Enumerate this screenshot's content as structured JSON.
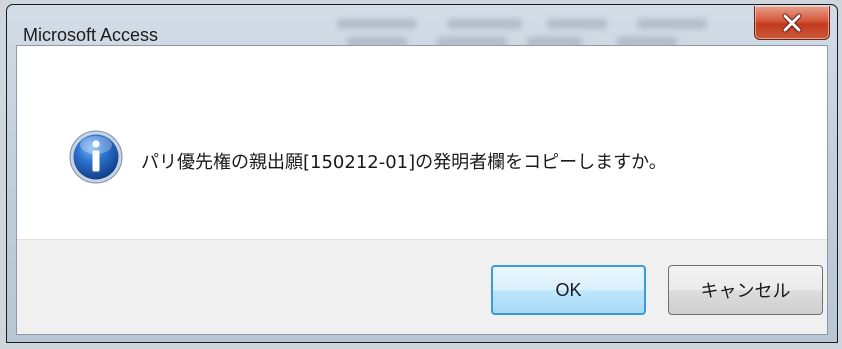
{
  "dialog": {
    "title": "Microsoft Access",
    "message": "パリ優先権の親出願[150212-01]の発明者欄をコピーしますか。",
    "icon": "information-icon",
    "ok_label": "OK",
    "cancel_label": "キャンセル",
    "close_icon": "close-icon"
  },
  "colors": {
    "close_button": "#c8452a",
    "ok_border": "#3c9ad8",
    "info_icon_blue": "#1f5fb8"
  }
}
